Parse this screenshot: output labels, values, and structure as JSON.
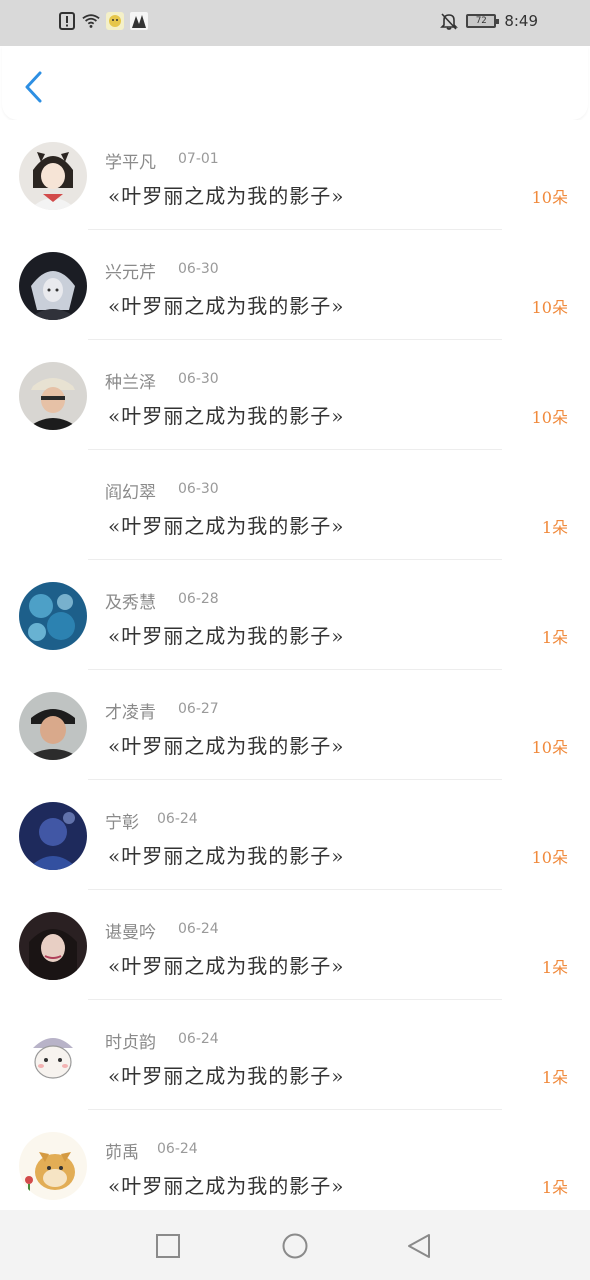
{
  "status_bar": {
    "time": "8:49",
    "battery": "72",
    "icons_left": [
      "alert-icon",
      "wifi-icon",
      "app-icon-1",
      "app-icon-2"
    ],
    "icons_right": [
      "bell-off-icon",
      "battery-icon"
    ]
  },
  "header": {
    "back_icon": "chevron-left-icon",
    "accent": "#2d8fe3"
  },
  "list": {
    "items": [
      {
        "name": "学平凡",
        "date": "07-01",
        "title": "«叶罗丽之成为我的影子»",
        "count": "10朵",
        "avatar": "anime-girl"
      },
      {
        "name": "兴元芹",
        "date": "06-30",
        "title": "«叶罗丽之成为我的影子»",
        "count": "10朵",
        "avatar": "dark-anime"
      },
      {
        "name": "种兰泽",
        "date": "06-30",
        "title": "«叶罗丽之成为我的影子»",
        "count": "10朵",
        "avatar": "person-hat"
      },
      {
        "name": "阎幻翠",
        "date": "06-30",
        "title": "«叶罗丽之成为我的影子»",
        "count": "1朵",
        "avatar": "none"
      },
      {
        "name": "及秀慧",
        "date": "06-28",
        "title": "«叶罗丽之成为我的影子»",
        "count": "1朵",
        "avatar": "blue-bubbles"
      },
      {
        "name": "才凌青",
        "date": "06-27",
        "title": "«叶罗丽之成为我的影子»",
        "count": "10朵",
        "avatar": "man-photo"
      },
      {
        "name": "宁彰",
        "date": "06-24",
        "title": "«叶罗丽之成为我的影子»",
        "count": "10朵",
        "avatar": "blue-dark"
      },
      {
        "name": "谌曼吟",
        "date": "06-24",
        "title": "«叶罗丽之成为我的影子»",
        "count": "1朵",
        "avatar": "woman-photo"
      },
      {
        "name": "时贞韵",
        "date": "06-24",
        "title": "«叶罗丽之成为我的影子»",
        "count": "1朵",
        "avatar": "cartoon-hamster"
      },
      {
        "name": "茆禹",
        "date": "06-24",
        "title": "«叶罗丽之成为我的影子»",
        "count": "1朵",
        "avatar": "doge"
      }
    ]
  },
  "colors": {
    "count": "#f08a3c",
    "name": "#8a8a8a",
    "title": "#333333"
  },
  "nav_bar": {
    "icons": [
      "square-icon",
      "circle-icon",
      "triangle-back-icon"
    ]
  }
}
